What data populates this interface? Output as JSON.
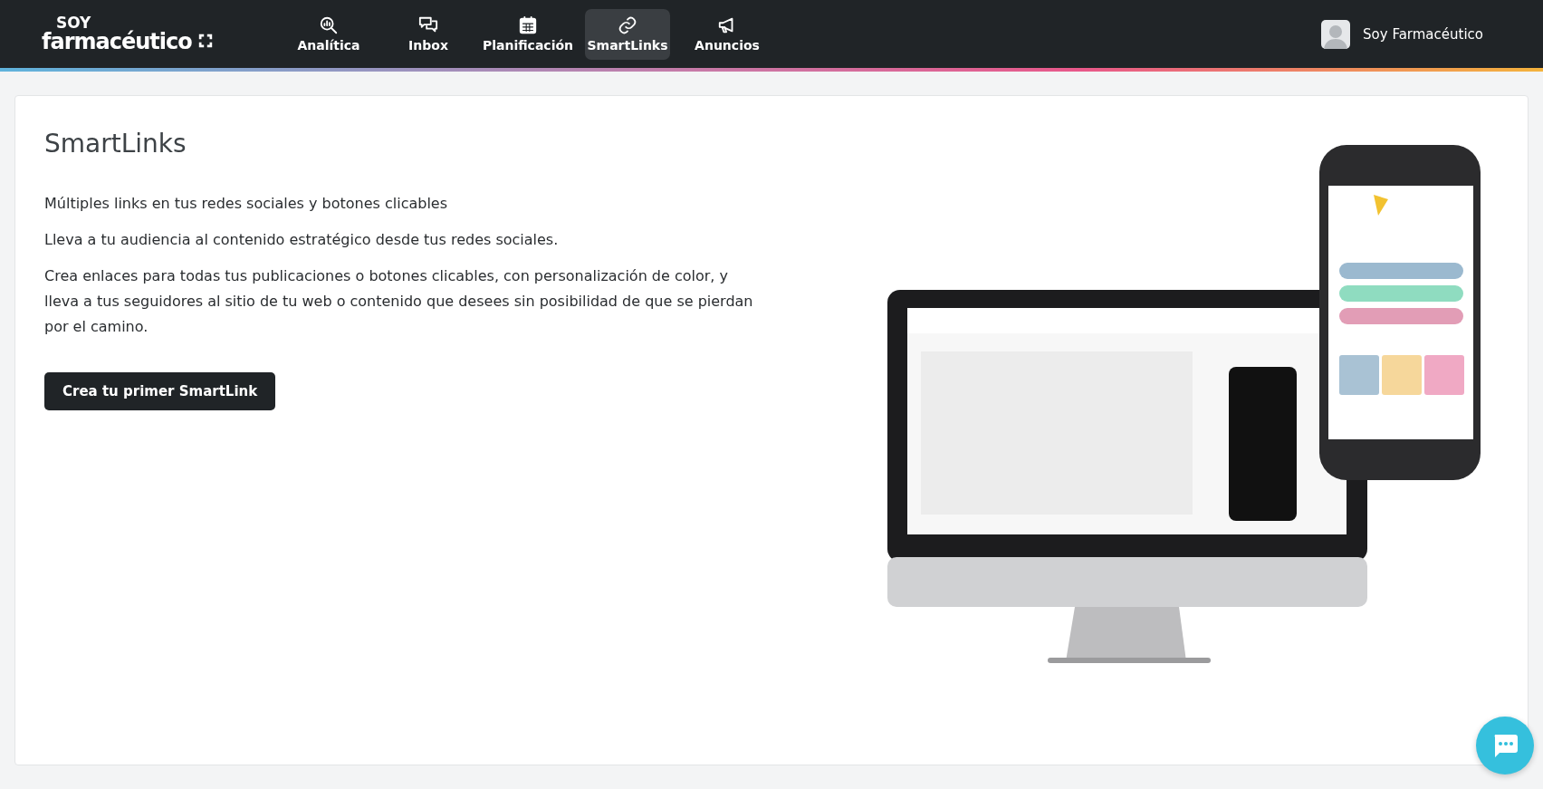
{
  "brand": {
    "top": "SOY",
    "bottom": "farmacéutico"
  },
  "nav": [
    {
      "label": "Analítica",
      "selected": false
    },
    {
      "label": "Inbox",
      "selected": false
    },
    {
      "label": "Planificación",
      "selected": false
    },
    {
      "label": "SmartLinks",
      "selected": true
    },
    {
      "label": "Anuncios",
      "selected": false
    }
  ],
  "user": {
    "name": "Soy Farmacéutico"
  },
  "page": {
    "title": "SmartLinks",
    "paragraphs": [
      "Múltiples links en tus redes sociales y botones clicables",
      "Lleva a tu audiencia al contenido estratégico desde tus redes sociales.",
      "Crea enlaces para todas tus publicaciones o botones clicables, con personalización de color, y lleva a tus seguidores al sitio de tu web o contenido que desees sin posibilidad de que se pierdan por el camino."
    ],
    "cta": "Crea tu primer SmartLink"
  }
}
